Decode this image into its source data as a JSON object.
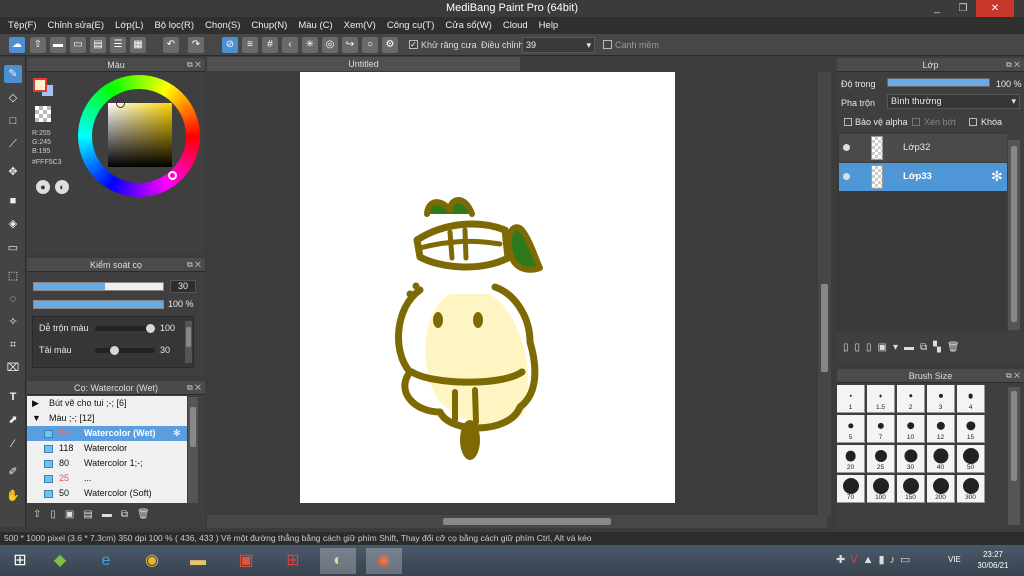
{
  "window": {
    "title": "MediBang Paint Pro (64bit)",
    "minimize": "_",
    "maximize": "❐",
    "close": "✕"
  },
  "menu": [
    "Tệp(F)",
    "Chỉnh sửa(E)",
    "Lớp(L)",
    "Bộ lọc(R)",
    "Chọn(S)",
    "Chụp(N)",
    "Màu (C)",
    "Xem(V)",
    "Công cụ(T)",
    "Cửa sổ(W)",
    "Cloud",
    "Help"
  ],
  "toolbar": {
    "antialias_label": "Khử răng cưa",
    "antialias_checked": true,
    "smooth_label": "Điều chỉnh",
    "smooth_value": "39",
    "snap_label": "Canh mềm",
    "snap_checked": false
  },
  "color_panel": {
    "title": "Màu",
    "r": "R:255",
    "g": "G:245",
    "b": "B:195",
    "hex": "#FFF5C3",
    "primary_color": "#FFF5C3",
    "secondary_color": "#9fc4f0"
  },
  "brush_control": {
    "title": "Kiểm soát cọ",
    "size_value": "30",
    "size_fill": 0.55,
    "opacity_value": "100 %",
    "opacity_fill": 1.0,
    "blend_label": "Dễ trộn màu",
    "blend_value": "100",
    "blend_fill": 1.0,
    "reload_label": "Tải màu",
    "reload_value": "30",
    "reload_fill": 0.3
  },
  "brush_panel": {
    "title": "Cọ: Watercolor (Wet)",
    "groups": [
      {
        "toggle": "▶",
        "label": "Bút vẽ cho tui ;-; [6]"
      },
      {
        "toggle": "▼",
        "label": "Màu ;-; [12]"
      }
    ],
    "brushes": [
      {
        "size": "30",
        "name": "Watercolor (Wet)",
        "selected": true
      },
      {
        "size": "118",
        "name": "Watercolor",
        "selected": false
      },
      {
        "size": "80",
        "name": "Watercolor 1;-;",
        "selected": false
      },
      {
        "size": "25",
        "name": "...",
        "selected": false
      },
      {
        "size": "50",
        "name": "Watercolor (Soft)",
        "selected": false
      }
    ]
  },
  "canvas": {
    "tab_title": "Untitled"
  },
  "layer_panel": {
    "title": "Lớp",
    "opacity_label": "Độ trong",
    "opacity_value": "100 %",
    "blend_label": "Pha trộn",
    "blend_value": "Bình thường",
    "protect_alpha": "Bảo vệ alpha",
    "clipping": "Xén bớt",
    "lock": "Khóa",
    "layers": [
      {
        "name": "Lớp32",
        "selected": false
      },
      {
        "name": "Lớp33",
        "selected": true
      }
    ]
  },
  "brush_size_panel": {
    "title": "Brush Size",
    "sizes": [
      "1",
      "1.5",
      "2",
      "3",
      "4",
      "5",
      "7",
      "10",
      "12",
      "15",
      "20",
      "25",
      "30",
      "40",
      "50",
      "70",
      "100",
      "150",
      "200",
      "300"
    ]
  },
  "status": {
    "text": "500 * 1000 pixel   (3.6 * 7.3cm)   350 dpi   100 %   ( 436, 433 )   Vẽ một đường thẳng bằng cách giữ phím Shift, Thay đổi cỡ cọ bằng cách giữ phím Ctrl, Alt và kéo"
  },
  "taskbar": {
    "lang": "VIE",
    "time": "23:27",
    "date": "30/06/21"
  },
  "colors": {
    "accent": "#4d8fd0",
    "drawing_olive": "#7d6a05",
    "drawing_green": "#2e7a1a",
    "drawing_cream": "#fff5c3"
  }
}
